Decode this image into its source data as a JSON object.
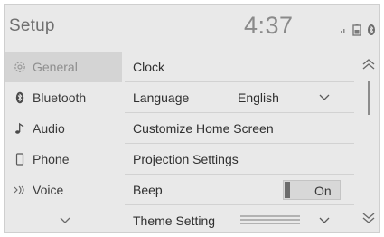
{
  "header": {
    "title": "Setup",
    "time": "4:37"
  },
  "status_icons": [
    "signal-icon",
    "phone-battery-icon",
    "bluetooth-connection-icon"
  ],
  "sidebar": {
    "items": [
      {
        "label": "General",
        "icon": "gear-icon",
        "selected": true
      },
      {
        "label": "Bluetooth",
        "icon": "bluetooth-icon",
        "selected": false
      },
      {
        "label": "Audio",
        "icon": "music-note-icon",
        "selected": false
      },
      {
        "label": "Phone",
        "icon": "phone-icon",
        "selected": false
      },
      {
        "label": "Voice",
        "icon": "voice-icon",
        "selected": false
      }
    ],
    "more_icon": "chevron-down-icon"
  },
  "list": {
    "rows": [
      {
        "label": "Clock"
      },
      {
        "label": "Language",
        "value": "English"
      },
      {
        "label": "Customize Home Screen"
      },
      {
        "label": "Projection Settings"
      },
      {
        "label": "Beep",
        "toggle": "On"
      },
      {
        "label": "Theme Setting"
      }
    ]
  },
  "scroll": {
    "up_icon": "double-chevron-up-icon",
    "down_icon": "double-chevron-down-icon"
  }
}
